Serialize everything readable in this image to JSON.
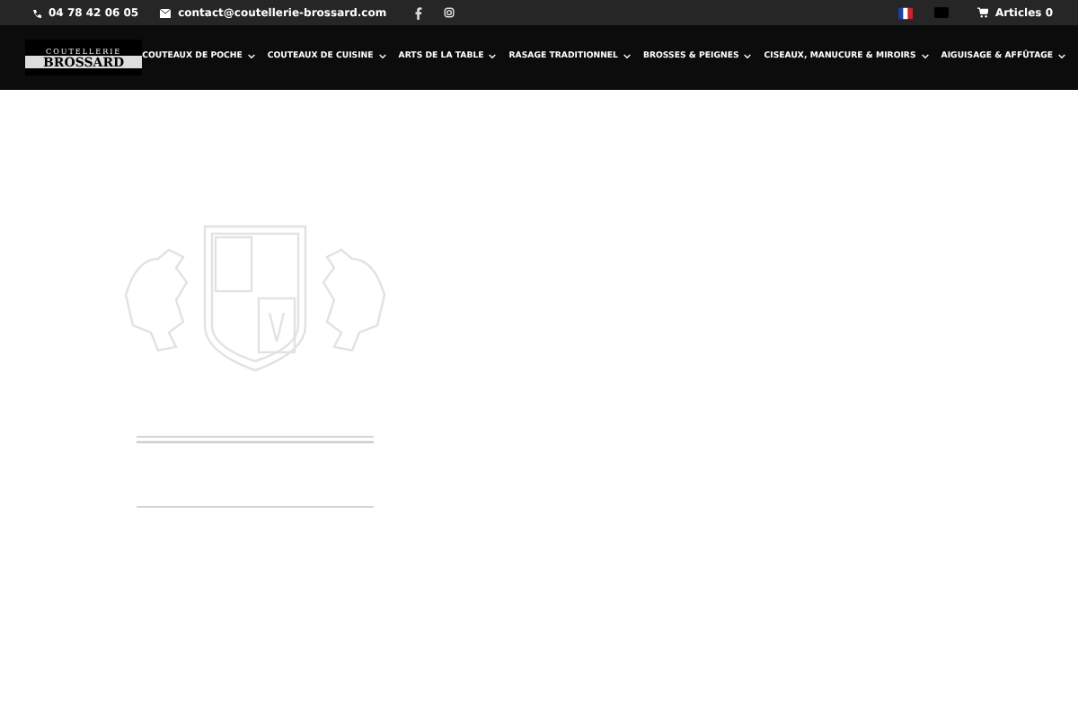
{
  "top_bar": {
    "phone": "04 78 42 06 05",
    "email": "contact@coutellerie-brossard.com",
    "cart": "Articles 0"
  },
  "logo": {
    "line_1": "COUTELLERIE",
    "line_2": "BROSSARD"
  },
  "menu": [
    {
      "label": "COUTEAUX DE POCHE"
    },
    {
      "label": "COUTEAUX DE CUISINE"
    },
    {
      "label": "ARTS DE LA TABLE"
    },
    {
      "label": "RASAGE TRADITIONNEL"
    },
    {
      "label": "BROSSES & PEIGNES"
    },
    {
      "label": "CISEAUX, MANUCURE & MIROIRS"
    },
    {
      "label": "AIGUISAGE & AFFÛTAGE"
    }
  ]
}
